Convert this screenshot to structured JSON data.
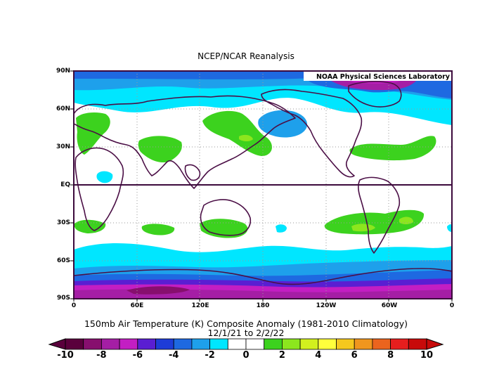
{
  "title": "NCEP/NCAR Reanalysis",
  "lab_label": "NOAA Physical Sciences Laboratory",
  "lat_labels": [
    "90N",
    "60N",
    "30N",
    "EQ",
    "30S",
    "60S",
    "90S"
  ],
  "lon_labels": [
    "0",
    "60E",
    "120E",
    "180",
    "120W",
    "60W",
    "0"
  ],
  "caption_line1": "150mb Air Temperature (K) Composite Anomaly (1981-2010 Climatology)",
  "caption_line2": "12/1/21  to 2/2/22",
  "colorbar": {
    "tick_labels": [
      "-10",
      "-8",
      "-6",
      "-4",
      "-2",
      "0",
      "2",
      "4",
      "6",
      "8",
      "10"
    ],
    "colors": [
      "#5a003c",
      "#870f6e",
      "#a51ea5",
      "#c31ec3",
      "#5a1ed2",
      "#1e3cd7",
      "#1e69e1",
      "#1ea0eb",
      "#00e6ff",
      "#ffffff",
      "#ffffff",
      "#3cd21e",
      "#8ce61e",
      "#d2f01e",
      "#ffff3c",
      "#f5c81e",
      "#f0961e",
      "#eb641e",
      "#e61e1e",
      "#c80a0a"
    ]
  },
  "colors": {
    "land_outline": "#4b0f46",
    "frame": "#3c0a3c",
    "positive_anomaly": "#3cd21e",
    "negative_anomaly": "#00e6ff"
  }
}
